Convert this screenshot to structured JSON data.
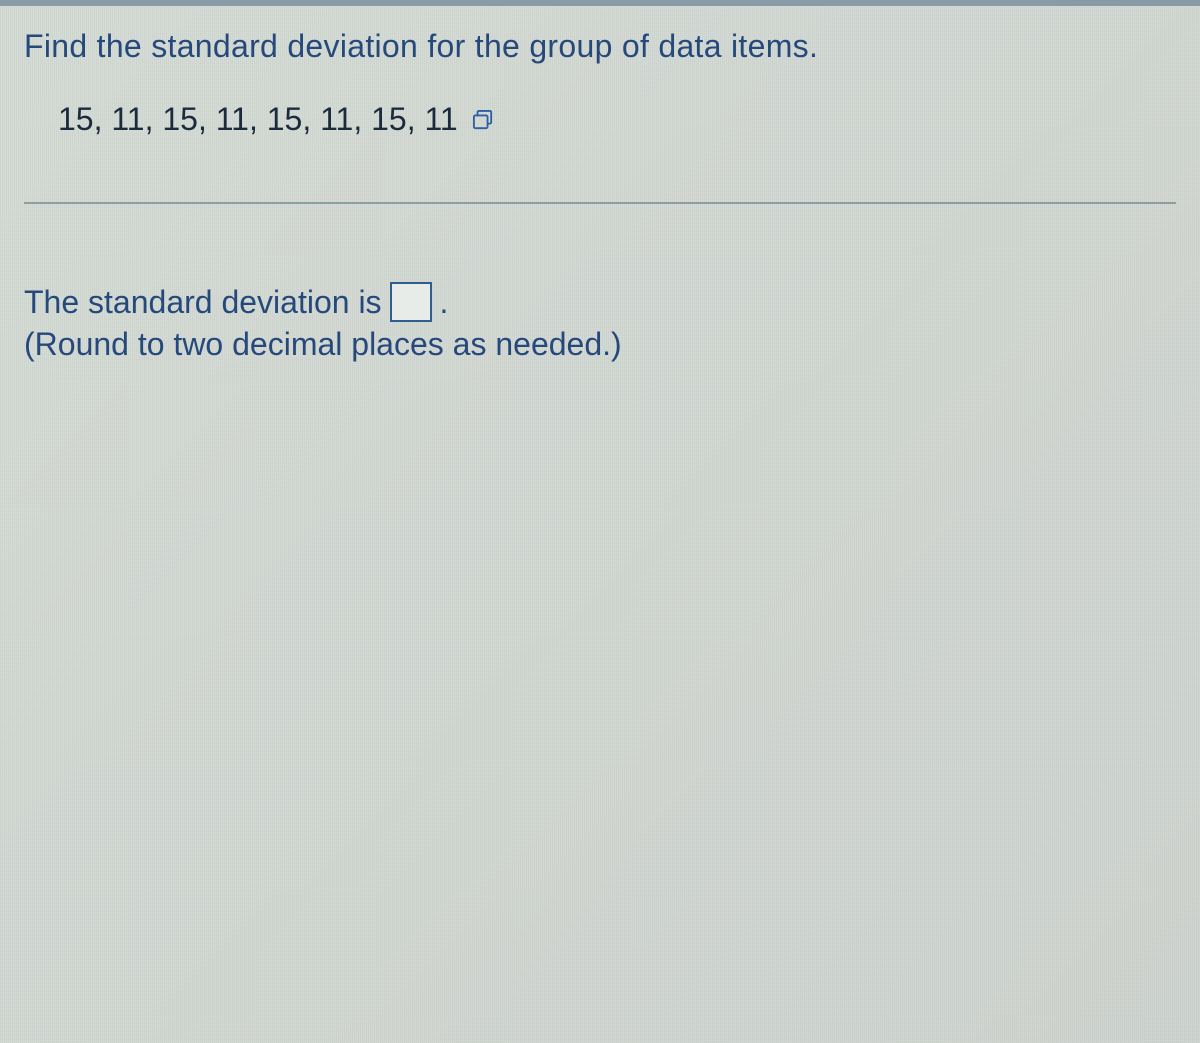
{
  "question": {
    "prompt": "Find the standard deviation for the group of data items.",
    "data_items": "15, 11, 15, 11, 15, 11, 15, 11"
  },
  "answer": {
    "lead": "The standard deviation is",
    "input_value": "",
    "trail": ".",
    "hint": "(Round to two decimal places as needed.)"
  }
}
